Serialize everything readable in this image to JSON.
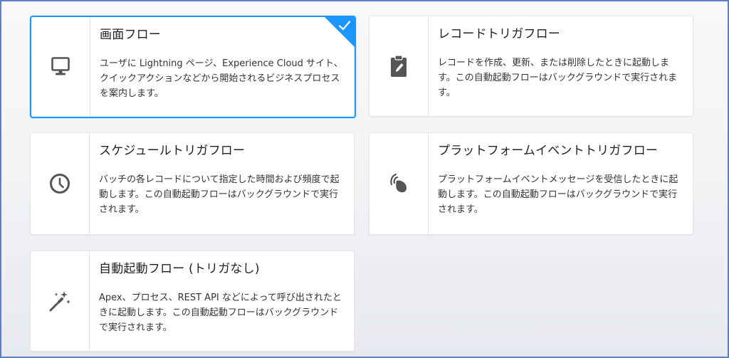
{
  "flow_types": [
    {
      "title": "画面フロー",
      "description": "ユーザに Lightning ページ、Experience Cloud サイト、クイックアクションなどから開始されるビジネスプロセスを案内します。",
      "icon": "monitor-icon",
      "selected": true
    },
    {
      "title": "レコードトリガフロー",
      "description": "レコードを作成、更新、または削除したときに起動します。この自動起動フローはバックグラウンドで実行されます。",
      "icon": "clipboard-edit-icon",
      "selected": false
    },
    {
      "title": "スケジュールトリガフロー",
      "description": "バッチの各レコードについて指定した時間および頻度で起動します。この自動起動フローはバックグラウンドで実行されます。",
      "icon": "clock-icon",
      "selected": false
    },
    {
      "title": "プラットフォームイベントトリガフロー",
      "description": "プラットフォームイベントメッセージを受信したときに起動します。この自動起動フローはバックグラウンドで実行されます。",
      "icon": "broadcast-icon",
      "selected": false
    },
    {
      "title": "自動起動フロー (トリガなし)",
      "description": "Apex、プロセス、REST API などによって呼び出されたときに起動します。この自動起動フローはバックグラウンドで実行されます。",
      "icon": "magic-wand-icon",
      "selected": false
    }
  ],
  "colors": {
    "selected_border": "#1b96ff",
    "icon": "#555555",
    "frame": "#5b7fc6"
  }
}
